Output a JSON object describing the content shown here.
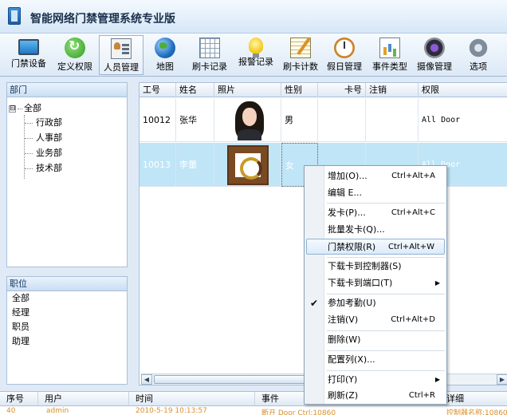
{
  "app": {
    "title": "智能网络门禁管理系统专业版"
  },
  "toolbar": {
    "items": [
      {
        "label": "门禁设备",
        "icon": "monitor-icon"
      },
      {
        "label": "定义权限",
        "icon": "refresh-icon"
      },
      {
        "label": "人员管理",
        "icon": "people-icon",
        "active": true
      },
      {
        "label": "地图",
        "icon": "globe-icon"
      },
      {
        "label": "刷卡记录",
        "icon": "grid-icon"
      },
      {
        "label": "报警记录",
        "icon": "bulb-icon"
      },
      {
        "label": "刷卡计数",
        "icon": "notepad-icon"
      },
      {
        "label": "假日管理",
        "icon": "clock-icon"
      },
      {
        "label": "事件类型",
        "icon": "chart-icon"
      },
      {
        "label": "摄像管理",
        "icon": "camera-icon"
      },
      {
        "label": "选项",
        "icon": "gear-icon"
      }
    ]
  },
  "departments": {
    "header": "部门",
    "root": "全部",
    "expander": "⊟",
    "children": [
      "行政部",
      "人事部",
      "业务部",
      "技术部"
    ]
  },
  "positions": {
    "header": "职位",
    "items": [
      "全部",
      "经理",
      "职员",
      "助理"
    ]
  },
  "table": {
    "columns": [
      "工号",
      "姓名",
      "照片",
      "性别",
      "卡号",
      "注销",
      "权限"
    ],
    "rows": [
      {
        "id": "10012",
        "name": "张华",
        "gender": "男",
        "card": "",
        "cancel": "",
        "permission": "All Door",
        "selected": false
      },
      {
        "id": "10013",
        "name": "李蕾",
        "gender": "女",
        "card": "",
        "cancel": "",
        "permission": "All Door",
        "selected": true
      }
    ]
  },
  "scrollbar": {
    "left_arrow": "◀",
    "right_arrow": "▶"
  },
  "log": {
    "columns": [
      "序号",
      "用户",
      "时间",
      "事件",
      "详细"
    ],
    "row": {
      "seq": "40",
      "user": "admin",
      "time": "2010-5-19 10:13:57",
      "event": "断开 Door Ctrl:10860",
      "detail": "控制器名称:10860"
    }
  },
  "context_menu": {
    "items": [
      {
        "label": "增加(O)...",
        "shortcut": "Ctrl+Alt+A"
      },
      {
        "label": "编辑 E...",
        "shortcut": ""
      },
      {
        "label": "发卡(P)...",
        "shortcut": "Ctrl+Alt+C"
      },
      {
        "label": "批量发卡(Q)...",
        "shortcut": ""
      },
      {
        "label": "门禁权限(R)",
        "shortcut": "Ctrl+Alt+W",
        "highlighted": true
      },
      {
        "label": "下载卡到控制器(S)",
        "shortcut": ""
      },
      {
        "label": "下载卡到端口(T)",
        "shortcut": "",
        "submenu": true
      },
      {
        "label": "参加考勤(U)",
        "shortcut": "",
        "checked": true
      },
      {
        "label": "注销(V)",
        "shortcut": "Ctrl+Alt+D"
      },
      {
        "label": "删除(W)",
        "shortcut": ""
      },
      {
        "label": "配置列(X)...",
        "shortcut": ""
      },
      {
        "label": "打印(Y)",
        "shortcut": "",
        "submenu": true
      },
      {
        "label": "刷新(Z)",
        "shortcut": "Ctrl+R"
      }
    ],
    "check_mark": "✔",
    "submenu_arrow": "▶"
  }
}
